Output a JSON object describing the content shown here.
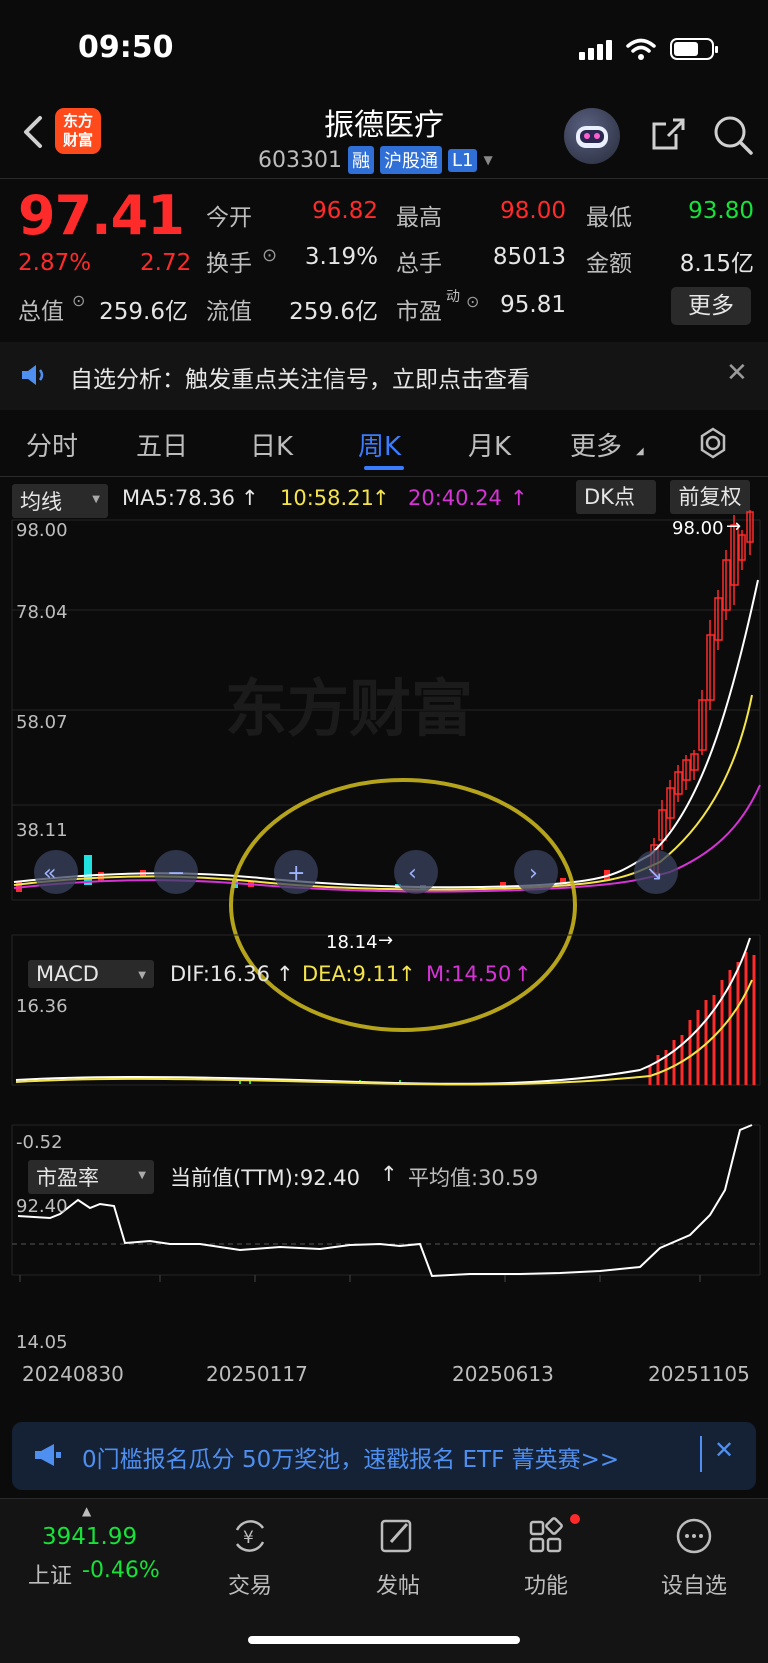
{
  "status_bar": {
    "time": "09:50"
  },
  "header": {
    "stock_name": "振德医疗",
    "code": "603301",
    "tags": [
      "融",
      "沪股通",
      "L1"
    ],
    "logo_text_line1": "东方",
    "logo_text_line2": "财富"
  },
  "quote": {
    "price": "97.41",
    "change_pct": "2.87%",
    "change_amt": "2.72",
    "fields": {
      "open_label": "今开",
      "open_value": "96.82",
      "high_label": "最高",
      "high_value": "98.00",
      "low_label": "最低",
      "low_value": "93.80",
      "turnover_label": "换手",
      "turnover_value": "3.19%",
      "volume_label": "总手",
      "volume_value": "85013",
      "amount_label": "金额",
      "amount_value": "8.15亿",
      "mktcap_label": "总值",
      "mktcap_value": "259.6亿",
      "float_label": "流值",
      "float_value": "259.6亿",
      "pe_label": "市盈",
      "pe_sup": "动",
      "pe_value": "95.81"
    },
    "more_label": "更多"
  },
  "notice": {
    "text": "自选分析：触发重点关注信号，立即点击查看"
  },
  "tabs": [
    {
      "label": "分时"
    },
    {
      "label": "五日"
    },
    {
      "label": "日K"
    },
    {
      "label": "周K"
    },
    {
      "label": "月K"
    },
    {
      "label": "更多"
    }
  ],
  "kline": {
    "indicator_select": "均线",
    "ma5": "MA5:78.36",
    "ma10": "10:58.21",
    "ma20": "20:40.24",
    "dk_label": "DK点",
    "adjust_label": "前复权",
    "y_labels": [
      "98.00",
      "78.04",
      "58.07",
      "38.11",
      "18.14"
    ],
    "max_marker": "98.00",
    "min_marker": "18.14",
    "watermark": "东方财富"
  },
  "macd": {
    "select": "MACD",
    "dif": "DIF:16.36",
    "dea": "DEA:9.11",
    "m": "M:14.50",
    "y_top": "16.36",
    "y_bottom": "-0.52"
  },
  "pe_chart": {
    "select": "市盈率",
    "current": "当前值(TTM):92.40",
    "average": "平均值:30.59",
    "y_top": "92.40",
    "y_bottom": "14.05",
    "x_labels": [
      "20240830",
      "20250117",
      "20250613",
      "20251105"
    ]
  },
  "ad": {
    "text": "0门槛报名瓜分 50万奖池，速戳报名 ETF 菁英赛>>"
  },
  "bottom_nav": {
    "index_value": "3941.99",
    "index_name": "上证",
    "index_change": "-0.46%",
    "items": [
      {
        "label": "交易"
      },
      {
        "label": "发帖"
      },
      {
        "label": "功能"
      },
      {
        "label": "设自选"
      }
    ]
  },
  "colors": {
    "up": "#ff2a2a",
    "down": "#17e23a",
    "accent": "#3b7cff",
    "ma10": "#f5e34a",
    "ma20": "#d633d6"
  }
}
